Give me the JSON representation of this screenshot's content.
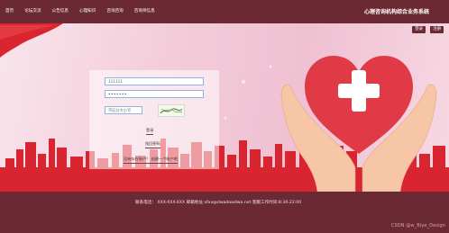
{
  "nav": {
    "items": [
      "首页",
      "论坛交流",
      "公告信息",
      "心理知识",
      "咨询咨询",
      "咨询师信息"
    ],
    "site_title": "心理咨询机构综合业务系统"
  },
  "header_buttons": {
    "left": "登录",
    "right": "注册"
  },
  "login": {
    "username_value": "111111",
    "password_value": "•••••••",
    "captcha_placeholder": "不区分大小写",
    "login_label": "登录",
    "forgot_label": "找回密码",
    "register_label": "没有存在账户？ 创建一个账户吧"
  },
  "footer": {
    "text": "联系电话：  XXX-XXX-XXX 邮箱地址:xfxx@dwadawdwa.net 客服工作时间:8:30-22:00",
    "watermark": "CSDN @w_Biye_Design"
  },
  "colors": {
    "brand": "#6b2a33",
    "heart_red": "#e03a46",
    "city_red": "#d9252f"
  }
}
